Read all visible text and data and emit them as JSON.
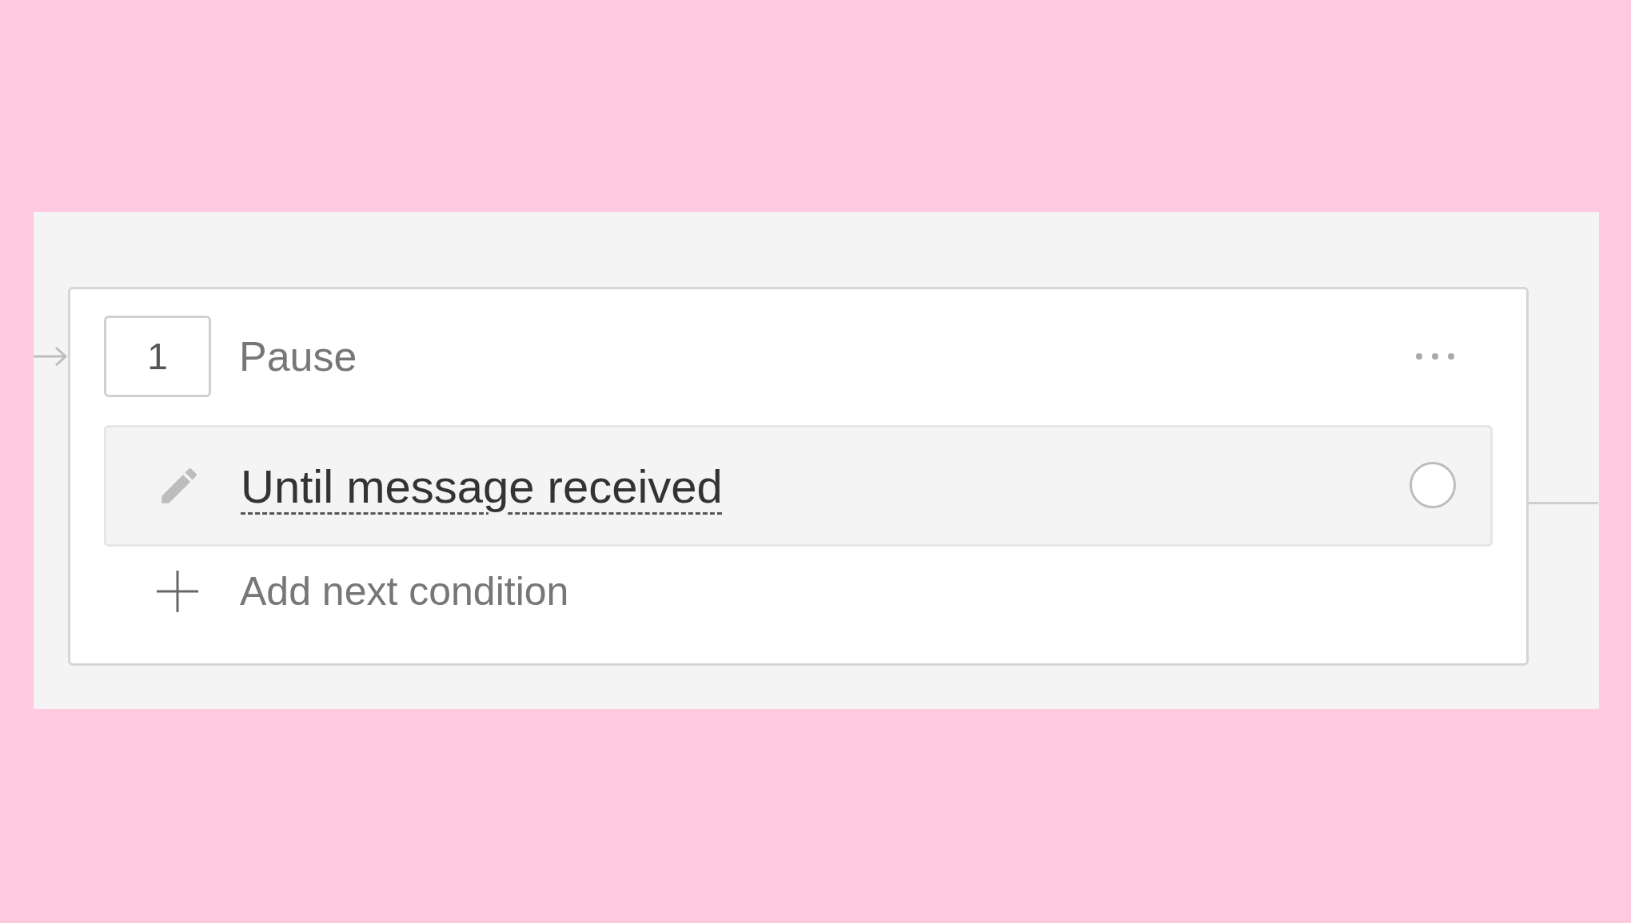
{
  "step": {
    "number": "1",
    "title": "Pause"
  },
  "conditions": [
    {
      "label": "Until message received"
    }
  ],
  "add_button": {
    "label": "Add next condition"
  }
}
